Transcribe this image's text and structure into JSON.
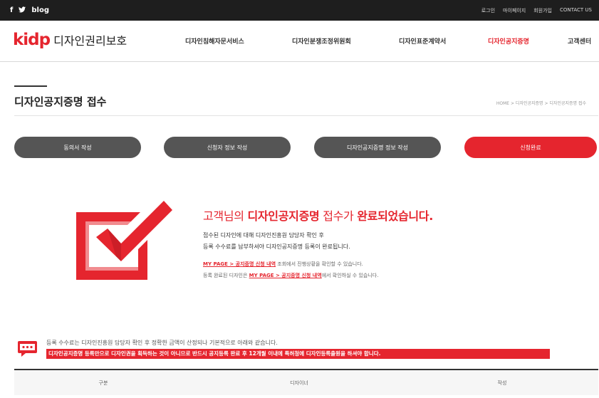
{
  "topbar": {
    "social": {
      "facebook": "f",
      "twitter": "🐦",
      "blog_label": "blog"
    },
    "links": [
      "로그인",
      "마이페이지",
      "회원가입",
      "CONTACT US"
    ]
  },
  "header": {
    "logo_mark": "kidp",
    "logo_name": "디자인권리보호",
    "nav": [
      "디자인침해자문서비스",
      "디자인분쟁조정위원회",
      "디자인표준계약서",
      "디자인공지증명",
      "고객센터"
    ]
  },
  "page": {
    "title": "디자인공지증명 접수",
    "breadcrumb": "HOME > 디자인공지증명 > 디자인공지증명 접수"
  },
  "steps": [
    {
      "label": "동의서 작성",
      "state": "normal"
    },
    {
      "label": "신청자 정보 작성",
      "state": "normal"
    },
    {
      "label": "디자인공지증명 정보 작성",
      "state": "normal"
    },
    {
      "label": "신청완료",
      "state": "active"
    }
  ],
  "message": {
    "title_pre": "고객님의 ",
    "title_highlight": "디자인공지증명",
    "title_mid": " 접수가 ",
    "title_post": "완료되었습니다.",
    "line1": "접수된 디자인에 대해 디자인진흥원 담당자 확인 후",
    "line2": "등록 수수료를 납부하셔야 디자인공지증명 등록이 완료됩니다.",
    "link1": "MY PAGE > 공지증명 신청 내역",
    "line3_rest": " 조회에서 진행상황을 확인할 수 있습니다.",
    "line4_pre": "등록 완료된 디자인은 ",
    "link2": "MY PAGE > 공지증명 신청 내역",
    "line4_rest": "에서 확인하실 수 있습니다."
  },
  "notice": {
    "text": "등록 수수료는 디자인진흥원 담당자 확인 후 정확한 금액이 산정되나 기본적으로 아래와 같습니다.",
    "alert": "디자인공지증명 등록만으로 디자인권을 획득하는 것이 아니므로 반드시 공지등록 완료 후 12개월 이내에 특허청에 디자인등록출원을 하셔야 합니다."
  },
  "table": {
    "headers": [
      "구분",
      "디자이너",
      "작성"
    ]
  },
  "colors": {
    "accent": "#e5252e",
    "topbar": "#1e1e1e",
    "step_normal": "#555555"
  }
}
